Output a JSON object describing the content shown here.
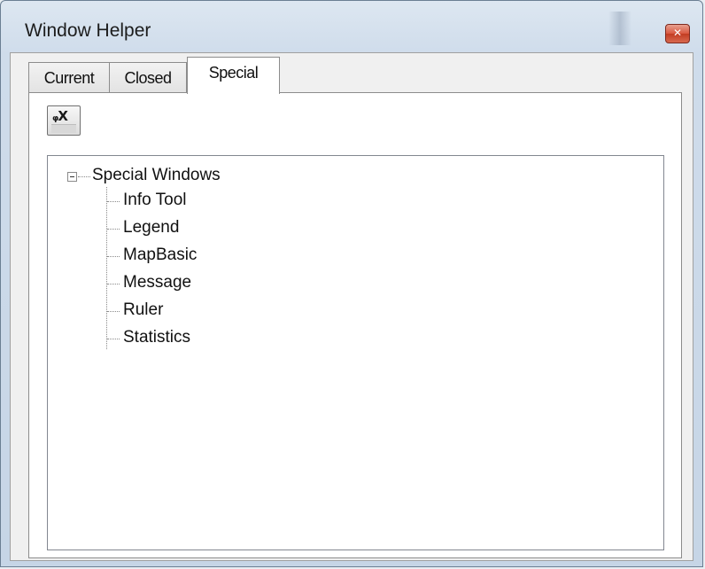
{
  "window": {
    "title": "Window Helper",
    "close_glyph": "✕"
  },
  "tabs": [
    {
      "label": "Current"
    },
    {
      "label": "Closed"
    },
    {
      "label": "Special"
    }
  ],
  "active_tab": "Special",
  "toolbar": {
    "unpin_button_icon": "unpin-close-icon",
    "unpin_glyph": "ᵩX"
  },
  "tree": {
    "root_label": "Special Windows",
    "expander_state": "expanded",
    "items": [
      {
        "label": "Info Tool"
      },
      {
        "label": "Legend"
      },
      {
        "label": "MapBasic"
      },
      {
        "label": "Message"
      },
      {
        "label": "Ruler"
      },
      {
        "label": "Statistics"
      }
    ]
  }
}
